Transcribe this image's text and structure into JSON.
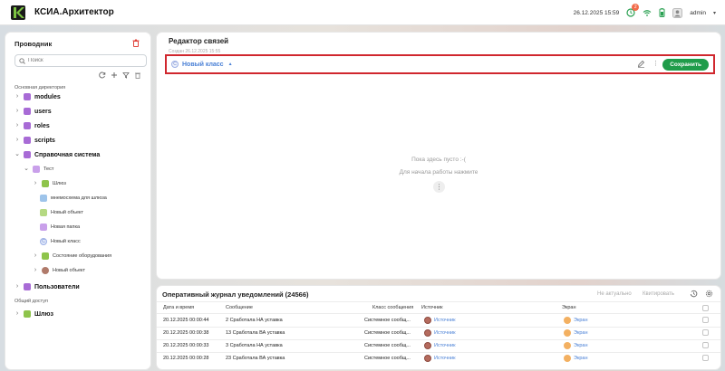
{
  "app": {
    "title": "КСИА.Архитектор",
    "datetime": "26.12.2025 15:59",
    "notification_count": "2",
    "user": "admin"
  },
  "explorer": {
    "title": "Проводник",
    "search_placeholder": "Поиск",
    "main_dir_label": "Основная директория",
    "shared_label": "Общий доступ",
    "items": [
      {
        "label": "modules"
      },
      {
        "label": "users"
      },
      {
        "label": "roles"
      },
      {
        "label": "scripts"
      },
      {
        "label": "Справочная система"
      },
      {
        "label": "Тест"
      },
      {
        "label": "Шлюз"
      },
      {
        "label": "мнемосхема для шлюза"
      },
      {
        "label": "Новый объект"
      },
      {
        "label": "Новая папка"
      },
      {
        "label": "Новый класс"
      },
      {
        "label": "Состояние оборудования"
      },
      {
        "label": "Новый объект"
      },
      {
        "label": "Пользователи"
      }
    ],
    "shared_items": [
      {
        "label": "Шлюз"
      }
    ]
  },
  "editor": {
    "title": "Редактор связей",
    "created": "Создан 26.12.2025 15:55",
    "class_badge": "C",
    "class_name": "Новый класс",
    "save_label": "Сохранить",
    "empty_line1": "Пока здесь пусто :-(",
    "empty_line2": "Для начала работы нажмите"
  },
  "journal": {
    "title": "Оперативный журнал уведомлений (24566)",
    "action_not_relevant": "Не актуально",
    "action_quote": "Квитировать",
    "columns": {
      "date": "Дата и время",
      "message": "Сообщение",
      "msg_class": "Класс сообщения",
      "source": "Источник",
      "screen": "Экран"
    },
    "rows": [
      {
        "date": "20.12.2025 00:00:44",
        "message": "2 Сработала НА уставка",
        "msg_class": "Системное сообщ...",
        "source": "Источник",
        "screen": "Экран"
      },
      {
        "date": "20.12.2025 00:00:38",
        "message": "13 Сработала ВА уставка",
        "msg_class": "Системное сообщ...",
        "source": "Источник",
        "screen": "Экран"
      },
      {
        "date": "20.12.2025 00:00:33",
        "message": "3 Сработала НА уставка",
        "msg_class": "Системное сообщ...",
        "source": "Источник",
        "screen": "Экран"
      },
      {
        "date": "20.12.2025 00:00:28",
        "message": "23 Сработала ВА уставка",
        "msg_class": "Системное сообщ...",
        "source": "Источник",
        "screen": "Экран"
      }
    ]
  },
  "colors": {
    "accent_green": "#1f9c4a",
    "highlight_red": "#d0272e",
    "link_blue": "#4a80d6",
    "folder_purple": "#a86bd6",
    "folder_green": "#8ec44b"
  }
}
